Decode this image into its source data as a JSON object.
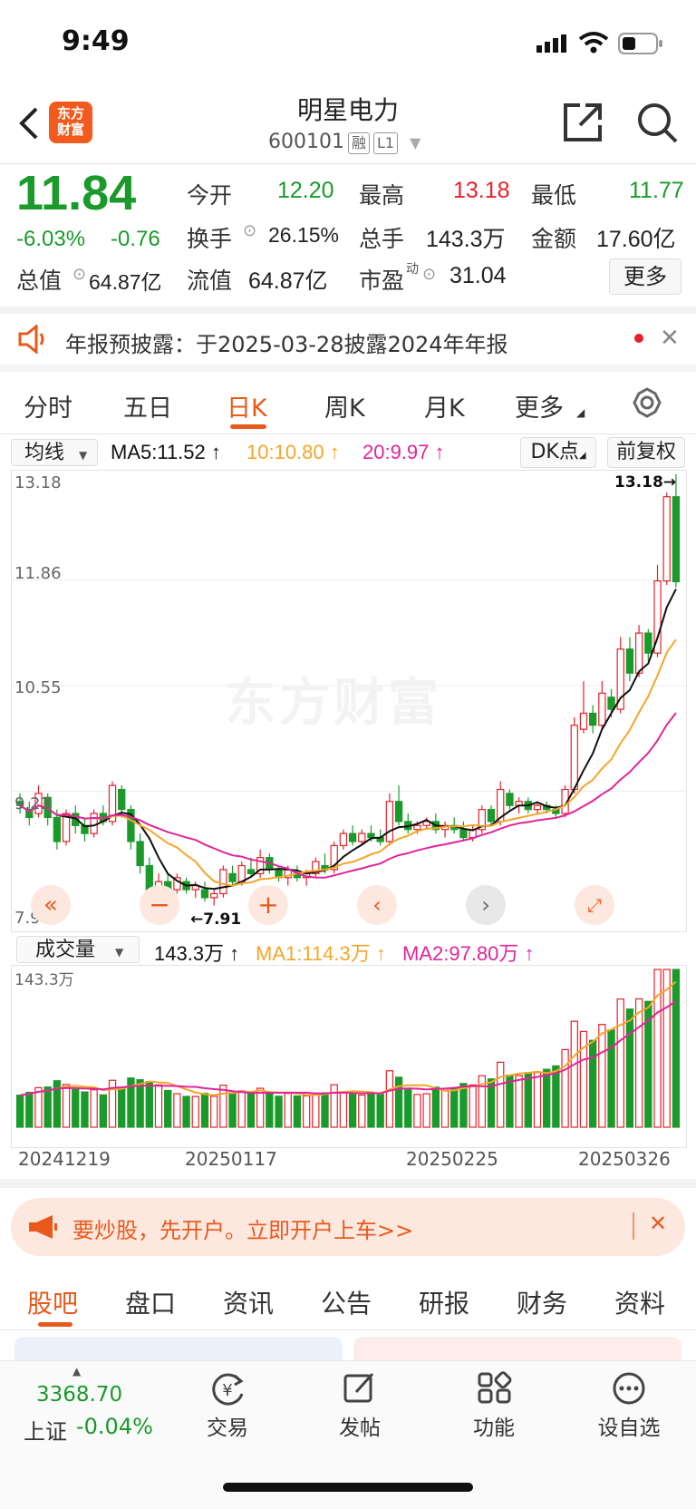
{
  "status": {
    "time": "9:49"
  },
  "header": {
    "title": "明星电力",
    "code": "600101",
    "tags": [
      "融",
      "L1"
    ],
    "logo_text": [
      "东方",
      "财富"
    ]
  },
  "quote": {
    "price": "11.84",
    "change_pct": "-6.03%",
    "change": "-0.76",
    "open_label": "今开",
    "open": "12.20",
    "high_label": "最高",
    "high": "13.18",
    "low_label": "最低",
    "low": "11.77",
    "turnover_label": "换手",
    "turnover": "26.15%",
    "volume_label": "总手",
    "volume": "143.3万",
    "amount_label": "金额",
    "amount": "17.60亿",
    "mktcap_label": "总值",
    "mktcap": "64.87亿",
    "float_label": "流值",
    "float": "64.87亿",
    "pe_label": "市盈",
    "pe_sup": "动",
    "pe": "31.04",
    "more": "更多"
  },
  "notice": {
    "text": "年报预披露：于2025-03-28披露2024年年报"
  },
  "chart_tabs": [
    "分时",
    "五日",
    "日K",
    "周K",
    "月K",
    "更多"
  ],
  "active_tab": "日K",
  "ma_bar": {
    "selector": "均线",
    "ma5": "MA5:11.52",
    "ma10": "10:10.80",
    "ma20": "20:9.97",
    "dk": "DK点",
    "fq": "前复权"
  },
  "kline": {
    "ylabels": [
      "13.18",
      "11.86",
      "10.55",
      "9.23",
      "7.91"
    ],
    "high_mark": "13.18→",
    "low_mark": "←7.91",
    "watermark": "东方财富"
  },
  "vol_bar": {
    "selector": "成交量",
    "vol": "143.3万",
    "ma1": "MA1:114.3万",
    "ma2": "MA2:97.80万",
    "max_label": "143.3万"
  },
  "dates": [
    "20241219",
    "20250117",
    "20250225",
    "20250326"
  ],
  "banner": {
    "text": "要炒股，先开户。立即开户上车>>"
  },
  "bottom_tabs": [
    "股吧",
    "盘口",
    "资讯",
    "公告",
    "研报",
    "财务",
    "资料"
  ],
  "nav": {
    "index_value": "3368.70",
    "index_name": "上证",
    "index_change": "-0.04%",
    "items": [
      "交易",
      "发帖",
      "功能",
      "设自选"
    ]
  },
  "colors": {
    "up": "#e8202a",
    "down": "#1a9a2a",
    "accent": "#e85a1c",
    "ma10": "#f4a62a",
    "ma20": "#e0249a"
  },
  "chart_data": {
    "type": "candlestick",
    "title": "",
    "ylim": [
      7.91,
      13.18
    ],
    "x_labels": [
      "20241219",
      "20250117",
      "20250225",
      "20250326"
    ],
    "ohlc": [
      [
        9.1,
        9.2,
        8.95,
        9.05
      ],
      [
        9.0,
        9.1,
        8.8,
        8.9
      ],
      [
        8.95,
        9.3,
        8.9,
        9.2
      ],
      [
        9.15,
        9.2,
        8.8,
        8.9
      ],
      [
        8.9,
        9.0,
        8.5,
        8.6
      ],
      [
        8.6,
        9.0,
        8.55,
        8.95
      ],
      [
        8.95,
        9.05,
        8.7,
        8.8
      ],
      [
        8.8,
        8.9,
        8.6,
        8.7
      ],
      [
        8.7,
        9.0,
        8.65,
        8.95
      ],
      [
        8.95,
        9.05,
        8.8,
        8.85
      ],
      [
        8.85,
        9.35,
        8.8,
        9.3
      ],
      [
        9.25,
        9.3,
        8.9,
        9.0
      ],
      [
        9.0,
        9.05,
        8.5,
        8.6
      ],
      [
        8.6,
        8.7,
        8.2,
        8.3
      ],
      [
        8.3,
        8.4,
        7.95,
        8.0
      ],
      [
        8.0,
        8.2,
        7.8,
        8.1
      ],
      [
        8.1,
        8.2,
        7.9,
        8.0
      ],
      [
        8.0,
        8.2,
        7.95,
        8.15
      ],
      [
        8.1,
        8.15,
        7.95,
        8.0
      ],
      [
        8.0,
        8.1,
        7.9,
        8.05
      ],
      [
        8.0,
        8.1,
        7.85,
        7.9
      ],
      [
        7.9,
        8.0,
        7.8,
        7.95
      ],
      [
        7.95,
        8.3,
        7.9,
        8.25
      ],
      [
        8.2,
        8.3,
        8.05,
        8.1
      ],
      [
        8.1,
        8.35,
        8.05,
        8.3
      ],
      [
        8.25,
        8.4,
        8.15,
        8.2
      ],
      [
        8.2,
        8.5,
        8.15,
        8.4
      ],
      [
        8.4,
        8.45,
        8.2,
        8.25
      ],
      [
        8.25,
        8.3,
        8.1,
        8.15
      ],
      [
        8.15,
        8.3,
        8.05,
        8.25
      ],
      [
        8.2,
        8.3,
        8.1,
        8.15
      ],
      [
        8.15,
        8.25,
        8.05,
        8.2
      ],
      [
        8.2,
        8.4,
        8.15,
        8.35
      ],
      [
        8.3,
        8.45,
        8.2,
        8.25
      ],
      [
        8.25,
        8.6,
        8.2,
        8.55
      ],
      [
        8.55,
        8.75,
        8.5,
        8.7
      ],
      [
        8.7,
        8.8,
        8.55,
        8.6
      ],
      [
        8.6,
        8.75,
        8.55,
        8.7
      ],
      [
        8.7,
        8.8,
        8.6,
        8.65
      ],
      [
        8.65,
        8.75,
        8.55,
        8.6
      ],
      [
        8.6,
        9.2,
        8.55,
        9.1
      ],
      [
        9.1,
        9.3,
        8.8,
        8.85
      ],
      [
        8.85,
        8.95,
        8.7,
        8.75
      ],
      [
        8.75,
        8.85,
        8.7,
        8.8
      ],
      [
        8.8,
        8.9,
        8.75,
        8.85
      ],
      [
        8.85,
        8.95,
        8.7,
        8.75
      ],
      [
        8.75,
        8.85,
        8.65,
        8.8
      ],
      [
        8.8,
        8.9,
        8.7,
        8.75
      ],
      [
        8.75,
        8.85,
        8.6,
        8.65
      ],
      [
        8.65,
        8.8,
        8.6,
        8.75
      ],
      [
        8.75,
        9.05,
        8.7,
        9.0
      ],
      [
        9.0,
        9.05,
        8.8,
        8.85
      ],
      [
        8.85,
        9.35,
        8.8,
        9.25
      ],
      [
        9.2,
        9.25,
        9.0,
        9.05
      ],
      [
        9.05,
        9.15,
        8.95,
        9.1
      ],
      [
        9.1,
        9.15,
        8.95,
        9.0
      ],
      [
        9.0,
        9.1,
        8.95,
        9.05
      ],
      [
        9.05,
        9.1,
        8.95,
        9.0
      ],
      [
        9.0,
        9.05,
        8.9,
        8.95
      ],
      [
        8.95,
        9.3,
        8.9,
        9.25
      ],
      [
        9.25,
        10.15,
        9.2,
        10.05
      ],
      [
        10.0,
        10.6,
        9.95,
        10.2
      ],
      [
        10.2,
        10.3,
        9.95,
        10.05
      ],
      [
        10.05,
        10.6,
        10.0,
        10.45
      ],
      [
        10.4,
        10.5,
        10.15,
        10.25
      ],
      [
        10.25,
        11.15,
        10.2,
        11.0
      ],
      [
        11.0,
        11.15,
        10.6,
        10.7
      ],
      [
        10.7,
        11.3,
        10.65,
        11.2
      ],
      [
        11.2,
        11.25,
        10.85,
        10.95
      ],
      [
        10.95,
        12.05,
        10.9,
        11.85
      ],
      [
        11.85,
        12.95,
        11.8,
        12.9
      ],
      [
        12.9,
        13.18,
        11.77,
        11.84
      ]
    ],
    "volume_max": "143.3万"
  }
}
